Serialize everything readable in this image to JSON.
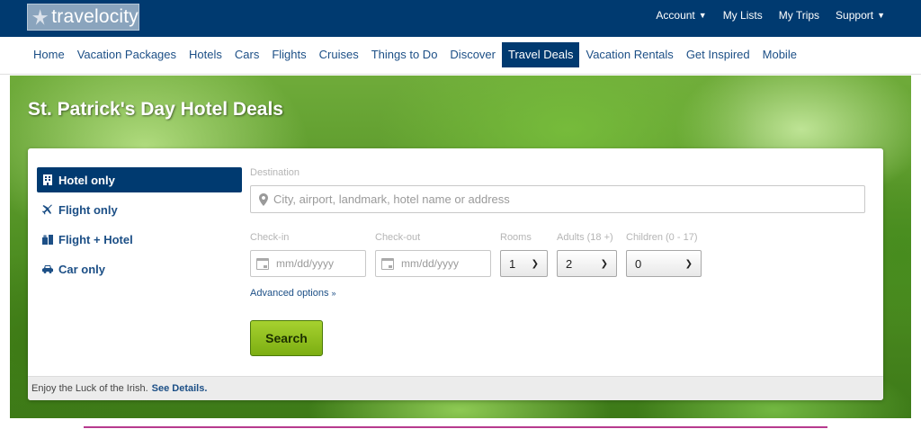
{
  "header": {
    "logo_text": "travelocity",
    "top_links": [
      {
        "label": "Account",
        "has_caret": true
      },
      {
        "label": "My Lists",
        "has_caret": false
      },
      {
        "label": "My Trips",
        "has_caret": false
      },
      {
        "label": "Support",
        "has_caret": true
      }
    ]
  },
  "nav": {
    "items": [
      "Home",
      "Vacation Packages",
      "Hotels",
      "Cars",
      "Flights",
      "Cruises",
      "Things to Do",
      "Discover",
      "Travel Deals",
      "Vacation Rentals",
      "Get Inspired",
      "Mobile"
    ],
    "active": "Travel Deals"
  },
  "hero": {
    "title": "St. Patrick's Day Hotel Deals"
  },
  "search": {
    "tabs": [
      {
        "label": "Hotel only",
        "icon": "building-icon",
        "active": true
      },
      {
        "label": "Flight only",
        "icon": "plane-icon",
        "active": false
      },
      {
        "label": "Flight + Hotel",
        "icon": "luggage-icon",
        "active": false
      },
      {
        "label": "Car only",
        "icon": "car-icon",
        "active": false
      }
    ],
    "destination_label": "Destination",
    "destination_placeholder": "City, airport, landmark, hotel name or address",
    "checkin_label": "Check-in",
    "checkin_placeholder": "mm/dd/yyyy",
    "checkout_label": "Check-out",
    "checkout_placeholder": "mm/dd/yyyy",
    "rooms_label": "Rooms",
    "rooms_value": "1",
    "adults_label": "Adults (18 +)",
    "adults_value": "2",
    "children_label": "Children (0 - 17)",
    "children_value": "0",
    "advanced_options": "Advanced options",
    "search_button": "Search"
  },
  "promo": {
    "text": "Enjoy the Luck of the Irish.",
    "link": "See Details."
  },
  "colors": {
    "brand_navy": "#003a70",
    "link_blue": "#1c4f86",
    "search_green": "#8cbf1f"
  }
}
